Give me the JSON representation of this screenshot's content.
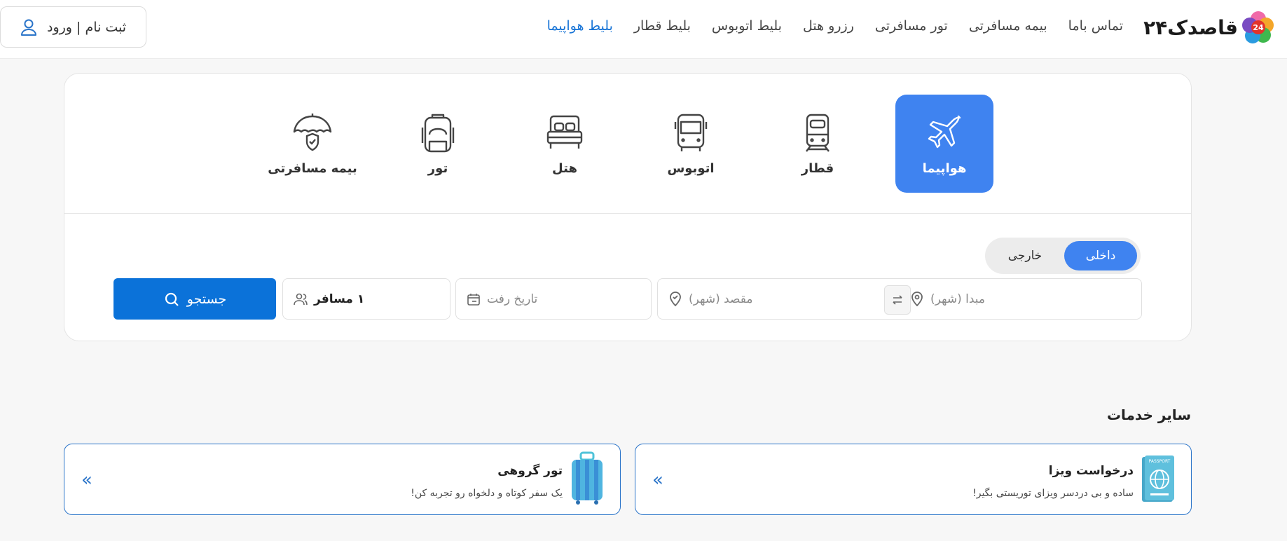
{
  "header": {
    "logo_text": "قاصدک۲۴",
    "logo_badge": "24",
    "nav": [
      {
        "label": "بلیط هواپیما",
        "active": true
      },
      {
        "label": "بلیط قطار",
        "active": false
      },
      {
        "label": "بلیط اتوبوس",
        "active": false
      },
      {
        "label": "رزرو هتل",
        "active": false
      },
      {
        "label": "تور مسافرتی",
        "active": false
      },
      {
        "label": "بیمه مسافرتی",
        "active": false
      },
      {
        "label": "تماس باما",
        "active": false
      }
    ],
    "login_label": "ثبت نام | ورود"
  },
  "services": [
    {
      "label": "هواپیما",
      "icon": "airplane-icon",
      "active": true
    },
    {
      "label": "قطار",
      "icon": "train-icon",
      "active": false
    },
    {
      "label": "اتوبوس",
      "icon": "bus-icon",
      "active": false
    },
    {
      "label": "هتل",
      "icon": "bed-icon",
      "active": false
    },
    {
      "label": "تور",
      "icon": "backpack-icon",
      "active": false
    },
    {
      "label": "بیمه مسافرتی",
      "icon": "umbrella-shield-icon",
      "active": false
    }
  ],
  "trip_type": {
    "domestic": "داخلی",
    "foreign": "خارجی",
    "selected": "domestic"
  },
  "search": {
    "origin_placeholder": "مبدا (شهر)",
    "destination_placeholder": "مقصد (شهر)",
    "date_placeholder": "تاریخ رفت",
    "passengers_value": "۱ مسافر",
    "search_label": "جستجو"
  },
  "other_services": {
    "title": "سایر خدمات",
    "items": [
      {
        "title": "درخواست ویزا",
        "subtitle": "ساده و بی دردسر ویزای توریستی بگیر!",
        "icon": "passport-icon"
      },
      {
        "title": "تور گروهی",
        "subtitle": "یک سفر کوتاه و دلخواه رو تجربه کن!",
        "icon": "suitcase-icon"
      }
    ]
  },
  "colors": {
    "primary": "#3f83f0",
    "button": "#0b72d9",
    "nav_active": "#1673d6",
    "promo_border": "#2a74c9"
  }
}
